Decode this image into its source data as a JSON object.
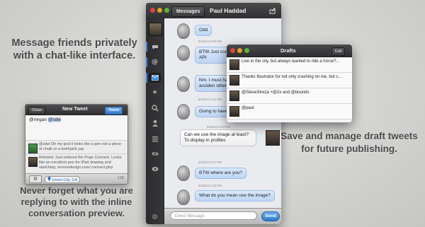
{
  "captions": {
    "top": "Message friends privately with a chat-like interface.",
    "bottom": "Never forget what you are replying to with the inline conversation preview.",
    "right": "Save and manage draft tweets for future publishing."
  },
  "messages_window": {
    "back_label": "Messages",
    "title": "Paul Haddad",
    "input_placeholder": "Direct Message",
    "send_label": "Send",
    "conversation": [
      {
        "side": "left",
        "text": "Odd",
        "time": ""
      },
      {
        "side": "left",
        "text": "BTW Just confi public API",
        "time": "9/18/12 8:09 PM"
      },
      {
        "side": "left",
        "text": "Nm. I must have acciden other button.",
        "time": ""
      },
      {
        "side": "left",
        "text": "Going to have",
        "time": "9/18/12 8:10 PM"
      },
      {
        "side": "right",
        "text": "Can we use the image at least? To display in profiles",
        "time": "9/18/12 8:13 PM"
      },
      {
        "side": "left",
        "text": "BTW where are you?",
        "time": "9/18/12 8:17 PM"
      },
      {
        "side": "left",
        "text": "What do you mean use the image?",
        "time": "9/18/12 8:19 PM"
      }
    ]
  },
  "drafts_window": {
    "title": "Drafts",
    "edit_label": "Edit",
    "drafts": [
      "Live in the city, but always wanted to ride a horse?...",
      "Thanks Illustrator for not only crashing on me, but c...",
      "@SteveStreza +@2x and @bounds",
      "@paul"
    ]
  },
  "new_tweet": {
    "close_label": "Close",
    "title": "New Tweet",
    "tweet_label": "Tweet",
    "compose_prefix": "@mrgan ",
    "compose_mention": "@sdw",
    "context": [
      "@sdw Oh my god it looks like a pen not a piece of chalk or a toothpick yay",
      "Relisted: Just ordered the Pogo Connect. Looks like an excellent pen for iPad drawing and sketching. tenonedesign.com/ connect.php"
    ],
    "location": "Union City, CA",
    "char_count": "128"
  }
}
